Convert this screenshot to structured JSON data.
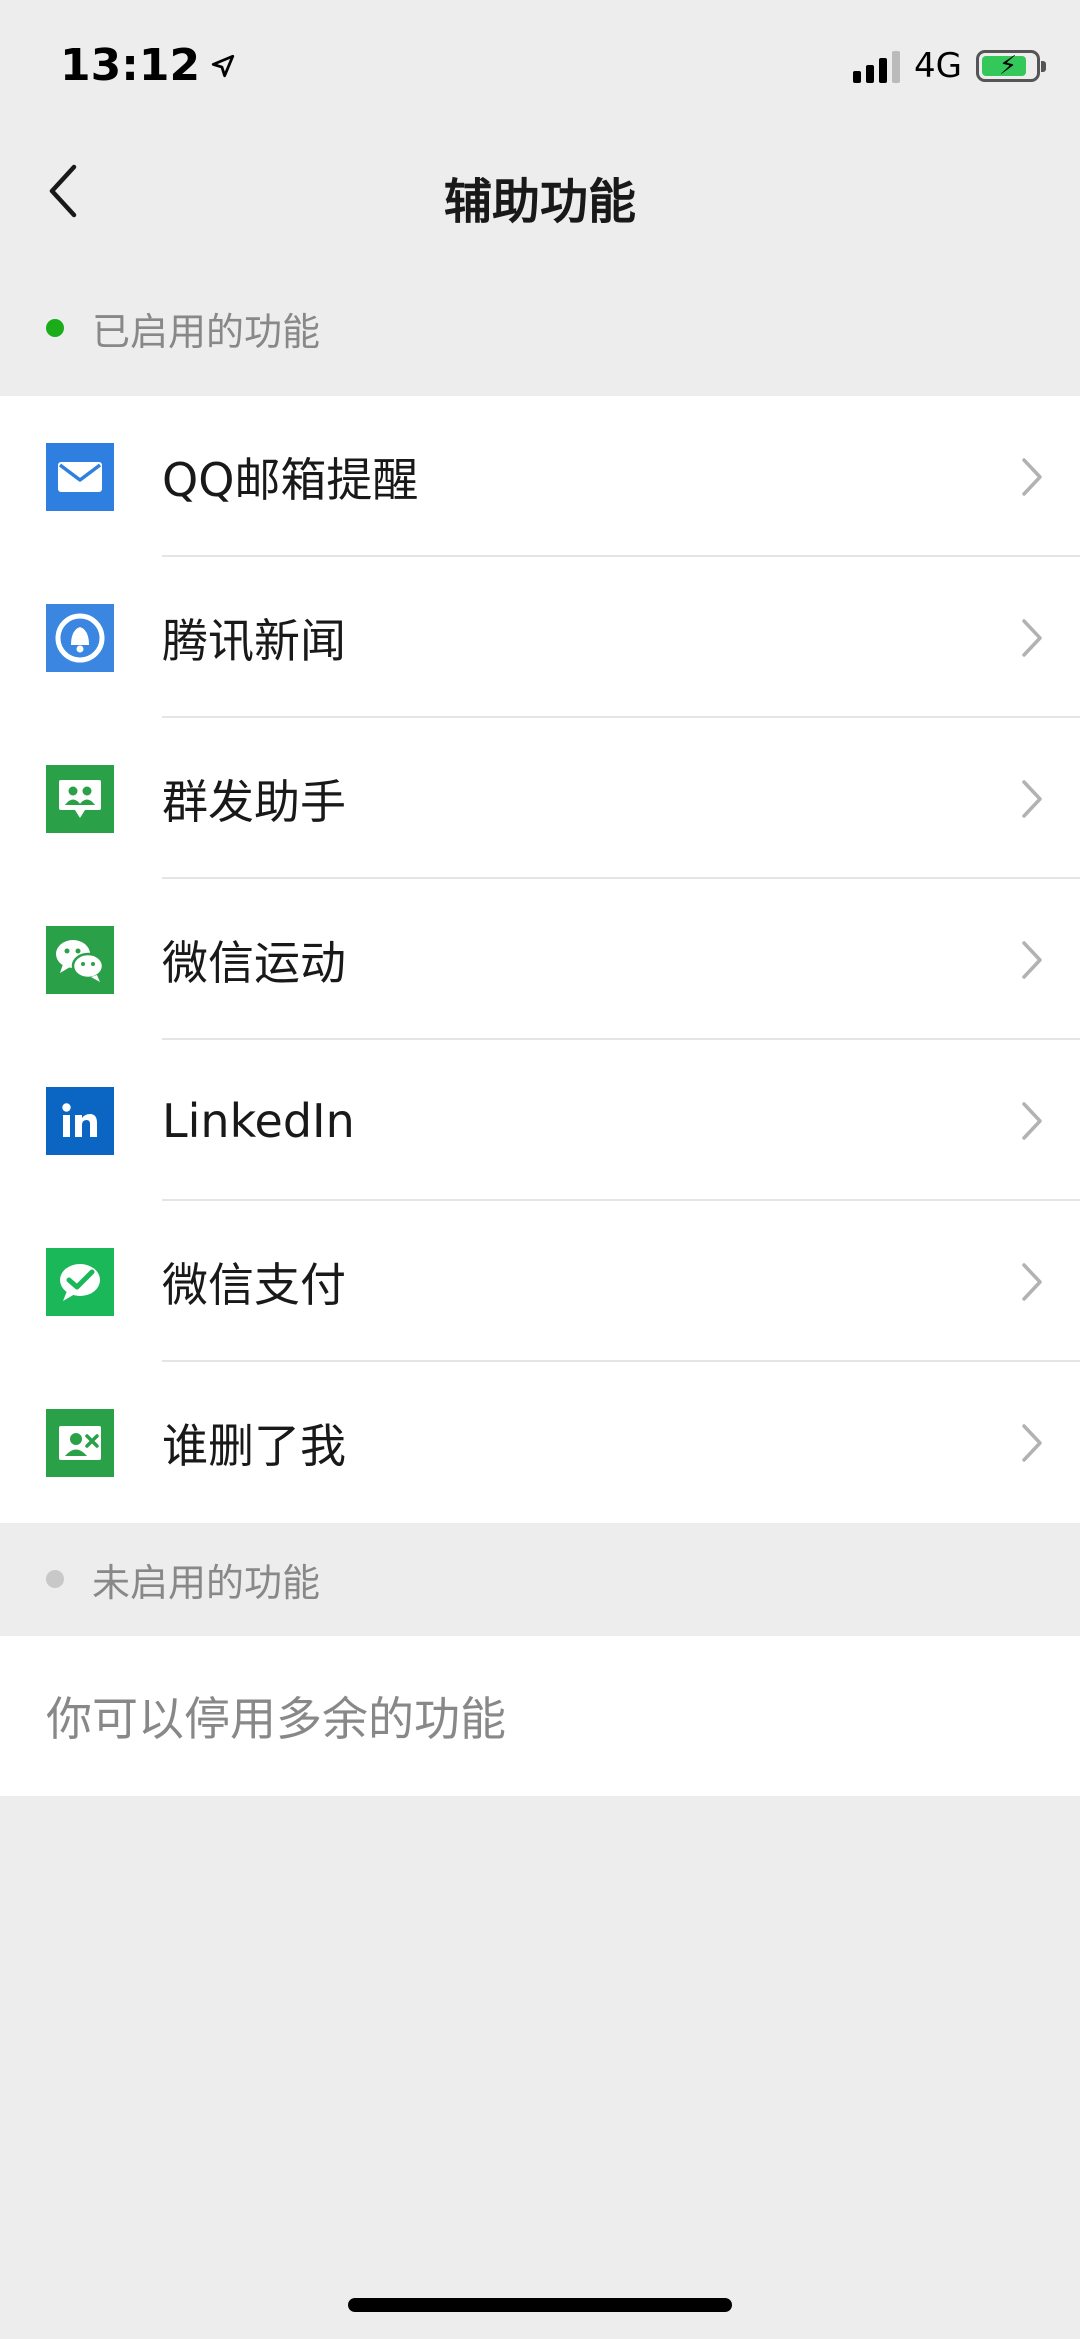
{
  "status_bar": {
    "time": "13:12",
    "network": "4G",
    "battery_level": 0.85
  },
  "nav": {
    "title": "辅助功能"
  },
  "sections": {
    "enabled_label": "已启用的功能",
    "disabled_label": "未启用的功能",
    "enabled_dot_color": "#1aad19",
    "disabled_dot_color": "#c8c8c8"
  },
  "enabled_items": [
    {
      "label": "QQ邮箱提醒",
      "icon": "mail-icon",
      "color": "#2f7fe0"
    },
    {
      "label": "腾讯新闻",
      "icon": "news-bell-icon",
      "color": "#3a86e0"
    },
    {
      "label": "群发助手",
      "icon": "group-message-icon",
      "color": "#2aa148"
    },
    {
      "label": "微信运动",
      "icon": "wechat-chat-icon",
      "color": "#2aa148"
    },
    {
      "label": "LinkedIn",
      "icon": "linkedin-icon",
      "color": "#0a66c2"
    },
    {
      "label": "微信支付",
      "icon": "wechat-pay-icon",
      "color": "#1bb85a"
    },
    {
      "label": "谁删了我",
      "icon": "contact-card-icon",
      "color": "#2aa148"
    }
  ],
  "disabled_hint": "你可以停用多余的功能"
}
